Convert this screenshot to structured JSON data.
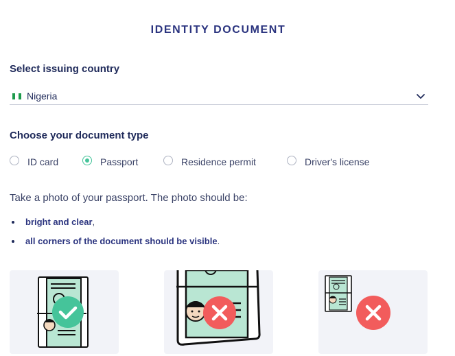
{
  "header": {
    "title": "IDENTITY DOCUMENT"
  },
  "country": {
    "label": "Select issuing country",
    "selected": "Nigeria",
    "flag_colors": [
      "#1d9a4c",
      "#ffffff",
      "#1d9a4c"
    ]
  },
  "doc_type": {
    "label": "Choose your document type",
    "options": [
      {
        "label": "ID card",
        "checked": false
      },
      {
        "label": "Passport",
        "checked": true
      },
      {
        "label": "Residence permit",
        "checked": false
      },
      {
        "label": "Driver's license",
        "checked": false
      }
    ]
  },
  "instructions": {
    "intro": "Take a photo of your passport. The photo should be:",
    "bullets": [
      {
        "bold": "bright and clear",
        "punct": ","
      },
      {
        "bold": "all corners of the document should be visible",
        "punct": "."
      }
    ]
  },
  "examples": [
    {
      "status": "correct",
      "icon": "check-icon"
    },
    {
      "status": "cropped",
      "icon": "cross-icon"
    },
    {
      "status": "too-small",
      "icon": "cross-icon"
    }
  ],
  "colors": {
    "accent_green": "#45c49a",
    "error_red": "#f25c5c",
    "title_blue": "#2b347f",
    "doc_mint": "#b9e6d3"
  }
}
